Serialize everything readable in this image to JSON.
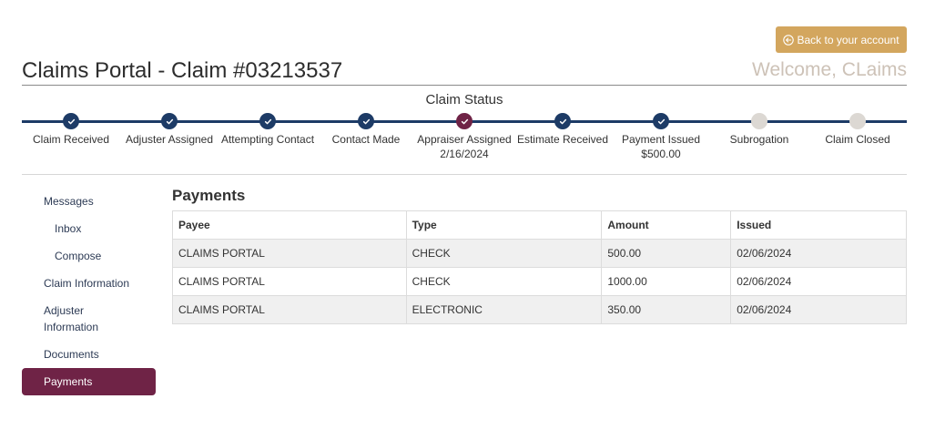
{
  "header": {
    "back_button_label": "Back to your account",
    "title": "Claims Portal - Claim #03213537",
    "welcome": "Welcome, CLaims"
  },
  "status": {
    "heading": "Claim Status",
    "steps": [
      {
        "label": "Claim Received",
        "state": "done",
        "sub": ""
      },
      {
        "label": "Adjuster Assigned",
        "state": "done",
        "sub": ""
      },
      {
        "label": "Attempting Contact",
        "state": "done",
        "sub": ""
      },
      {
        "label": "Contact Made",
        "state": "done",
        "sub": ""
      },
      {
        "label": "Appraiser Assigned",
        "state": "current",
        "sub": "2/16/2024"
      },
      {
        "label": "Estimate Received",
        "state": "done",
        "sub": ""
      },
      {
        "label": "Payment Issued",
        "state": "done",
        "sub": "$500.00"
      },
      {
        "label": "Subrogation",
        "state": "pending",
        "sub": ""
      },
      {
        "label": "Claim Closed",
        "state": "pending",
        "sub": ""
      }
    ],
    "colors": {
      "done": "#1d3b66",
      "current": "#6f2346",
      "pending": "#dcd8d3"
    }
  },
  "sidebar": {
    "items": [
      {
        "label": "Messages"
      },
      {
        "label": "Inbox"
      },
      {
        "label": "Compose"
      },
      {
        "label": "Claim Information"
      },
      {
        "label": "Adjuster Information"
      },
      {
        "label": "Documents"
      },
      {
        "label": "Payments"
      }
    ]
  },
  "payments": {
    "title": "Payments",
    "columns": [
      "Payee",
      "Type",
      "Amount",
      "Issued"
    ],
    "rows": [
      [
        "CLAIMS PORTAL",
        "CHECK",
        "500.00",
        "02/06/2024"
      ],
      [
        "CLAIMS PORTAL",
        "CHECK",
        "1000.00",
        "02/06/2024"
      ],
      [
        "CLAIMS PORTAL",
        "ELECTRONIC",
        "350.00",
        "02/06/2024"
      ]
    ]
  }
}
